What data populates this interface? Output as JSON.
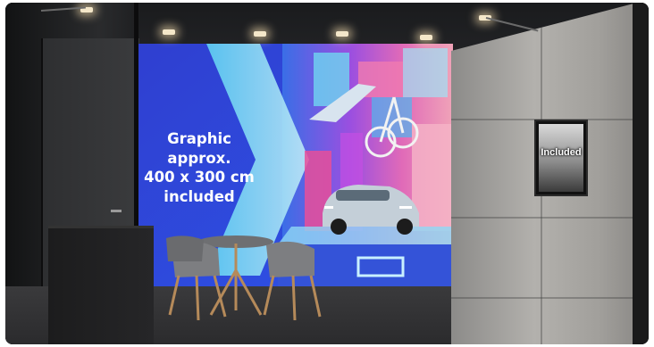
{
  "scene": {
    "graphic_text_lines": [
      "Graphic",
      "approx.",
      "400 x 300 cm",
      "included"
    ],
    "screen_label": "Included"
  }
}
